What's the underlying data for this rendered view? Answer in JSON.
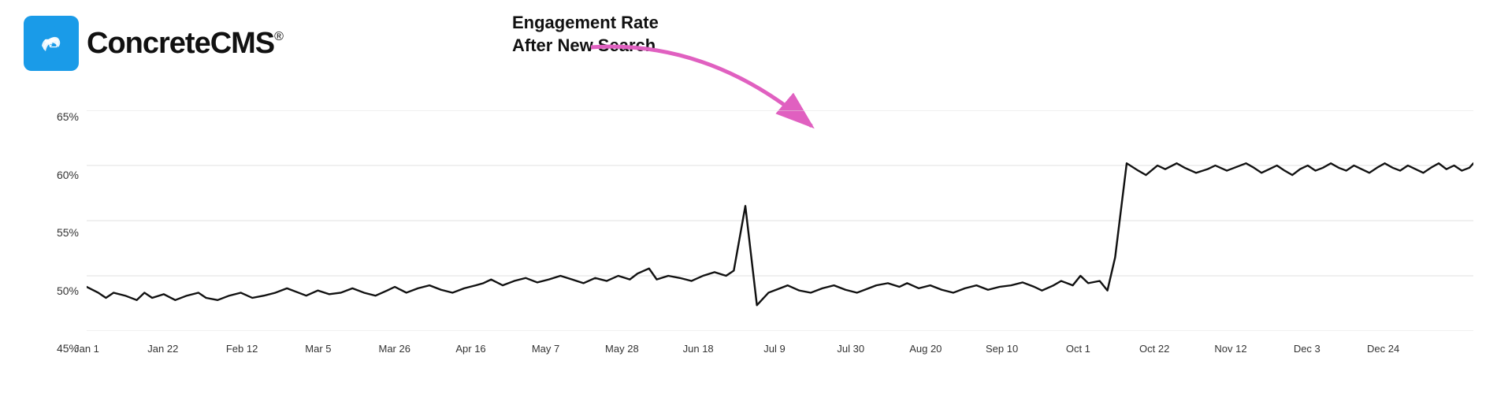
{
  "logo": {
    "alt": "ConcreteCMS",
    "text": "ConcreteCMS",
    "registered": "®"
  },
  "annotation": {
    "line1": "Engagement Rate",
    "line2": "After New Search"
  },
  "y_axis": {
    "labels": [
      "65%",
      "60%",
      "55%",
      "50%",
      "45%"
    ]
  },
  "x_axis": {
    "labels": [
      "Jan 1",
      "Jan 22",
      "Feb 12",
      "Mar 5",
      "Mar 26",
      "Apr 16",
      "May 7",
      "May 28",
      "Jun 18",
      "Jul 9",
      "Jul 30",
      "Aug 20",
      "Sep 10",
      "Oct 1",
      "Oct 22",
      "Nov 12",
      "Dec 3",
      "Dec 24"
    ]
  },
  "chart": {
    "title": "Engagement Rate After New Search"
  }
}
